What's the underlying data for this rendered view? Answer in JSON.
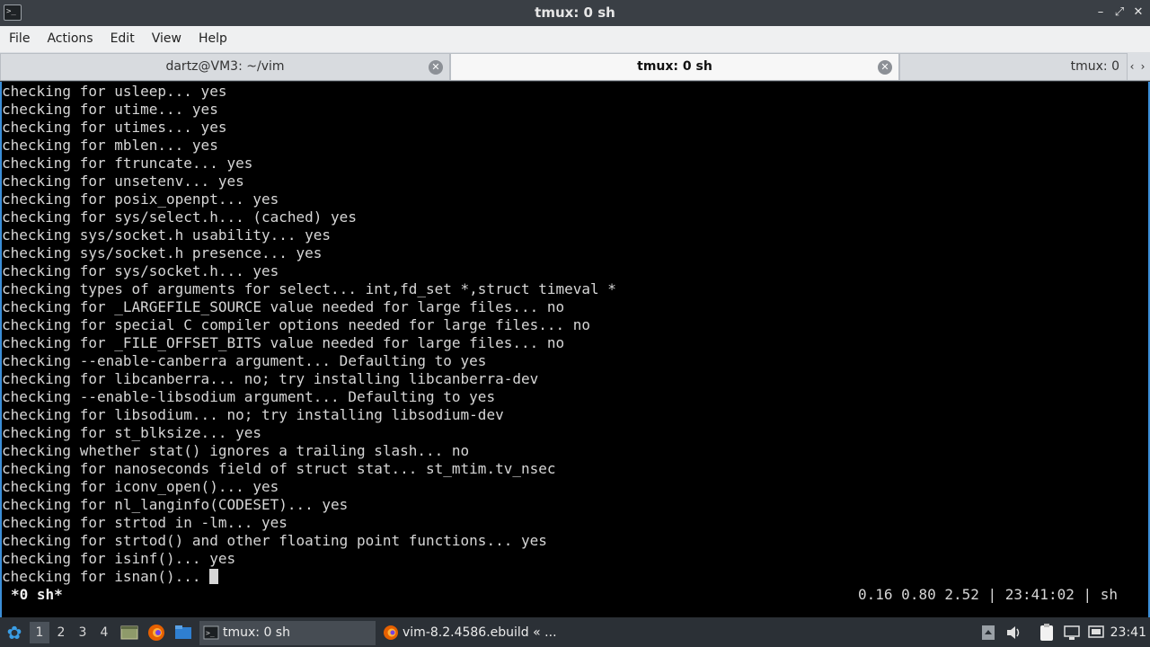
{
  "window": {
    "title": "tmux: 0 sh",
    "app_icon_glyph": ">_"
  },
  "menu": [
    "File",
    "Actions",
    "Edit",
    "View",
    "Help"
  ],
  "tabs": [
    {
      "label": "dartz@VM3: ~/vim",
      "active": false
    },
    {
      "label": "tmux: 0 sh",
      "active": true
    },
    {
      "label": "tmux: 0",
      "active": false
    }
  ],
  "terminal": {
    "lines": [
      "checking for usleep... yes",
      "checking for utime... yes",
      "checking for utimes... yes",
      "checking for mblen... yes",
      "checking for ftruncate... yes",
      "checking for unsetenv... yes",
      "checking for posix_openpt... yes",
      "checking for sys/select.h... (cached) yes",
      "checking sys/socket.h usability... yes",
      "checking sys/socket.h presence... yes",
      "checking for sys/socket.h... yes",
      "checking types of arguments for select... int,fd_set *,struct timeval *",
      "checking for _LARGEFILE_SOURCE value needed for large files... no",
      "checking for special C compiler options needed for large files... no",
      "checking for _FILE_OFFSET_BITS value needed for large files... no",
      "checking --enable-canberra argument... Defaulting to yes",
      "checking for libcanberra... no; try installing libcanberra-dev",
      "checking --enable-libsodium argument... Defaulting to yes",
      "checking for libsodium... no; try installing libsodium-dev",
      "checking for st_blksize... yes",
      "checking whether stat() ignores a trailing slash... no",
      "checking for nanoseconds field of struct stat... st_mtim.tv_nsec",
      "checking for iconv_open()... yes",
      "checking for nl_langinfo(CODESET)... yes",
      "checking for strtod in -lm... yes",
      "checking for strtod() and other floating point functions... yes",
      "checking for isinf()... yes"
    ],
    "current_line": "checking for isnan()... ",
    "status_left": "*0 sh*",
    "status_right": "0.16 0.80 2.52 | 23:41:02 | sh"
  },
  "taskbar": {
    "workspaces": [
      "1",
      "2",
      "3",
      "4"
    ],
    "active_workspace": "1",
    "tasks": [
      {
        "label": "tmux: 0 sh",
        "active": true,
        "icon": "terminal-icon"
      },
      {
        "label": "vim-8.2.4586.ebuild « ...",
        "active": false,
        "icon": "firefox-icon"
      }
    ],
    "clock": "23:41"
  },
  "colors": {
    "terminal_bg": "#000000",
    "terminal_fg": "#d6d6d6",
    "accent_border": "#3b8ed8",
    "taskbar_bg": "#2b3036"
  }
}
